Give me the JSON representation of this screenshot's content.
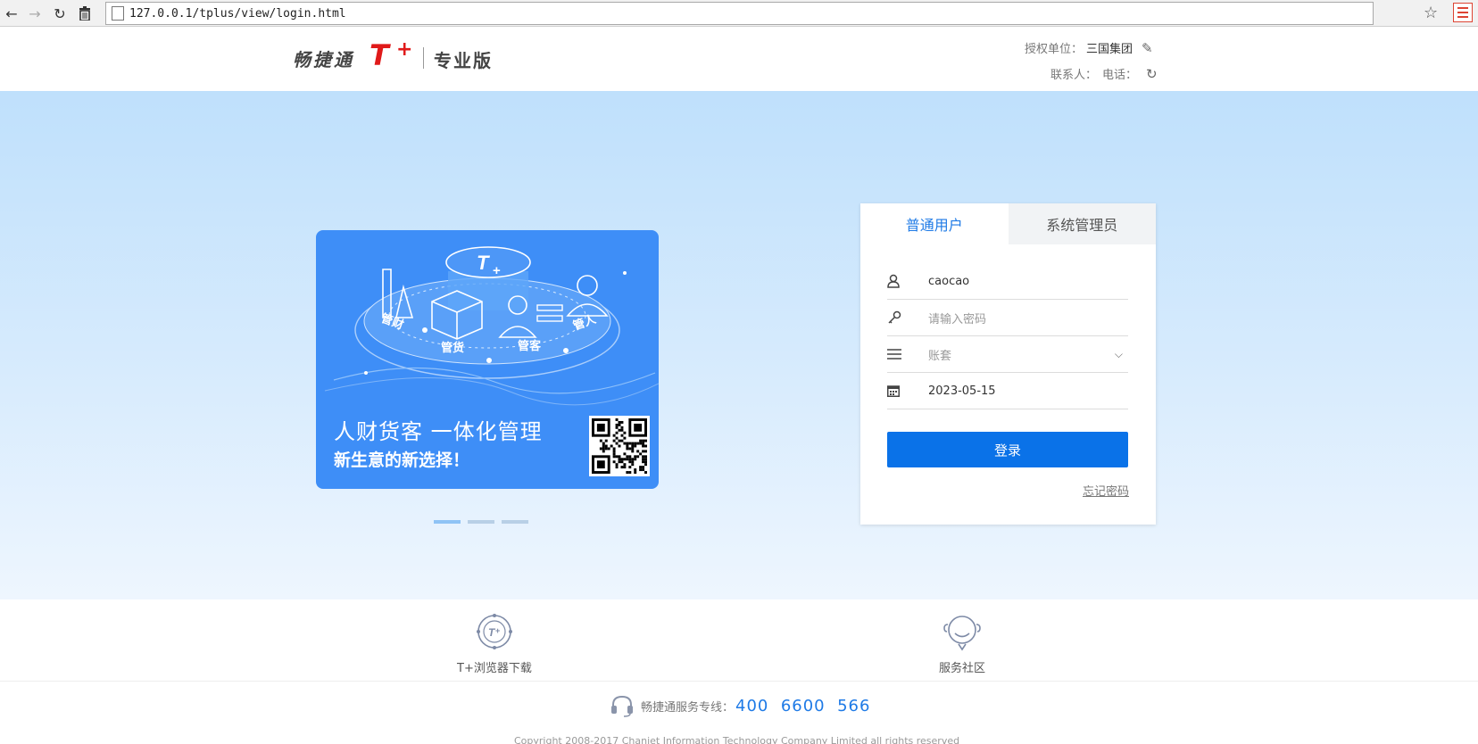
{
  "browser": {
    "url": "127.0.0.1/tplus/view/login.html",
    "back_icon": "back-arrow-icon",
    "forward_icon": "forward-arrow-icon",
    "reload_icon": "reload-icon",
    "trash_icon": "trash-icon",
    "bookmark_icon": "star-icon",
    "menu_icon": "hamburger-menu-icon"
  },
  "header": {
    "logo_text": "畅捷通",
    "logo_t": "T",
    "logo_plus": "+",
    "edition": "专业版",
    "auth_label": "授权单位：",
    "auth_value": "三国集团",
    "contact_label": "联系人：",
    "phone_label": "电话："
  },
  "banner": {
    "art_labels": [
      "管财",
      "管货",
      "管客",
      "管人"
    ],
    "headline": "人财货客 一体化管理",
    "subline": "新生意的新选择！"
  },
  "login": {
    "tabs": [
      {
        "label": "普通用户",
        "active": true
      },
      {
        "label": "系统管理员",
        "active": false
      }
    ],
    "username": "caocao",
    "password_placeholder": "请输入密码",
    "account_placeholder": "账套",
    "date": "2023-05-15",
    "submit_label": "登录",
    "forgot_label": "忘记密码"
  },
  "links": [
    {
      "label": "T+浏览器下载",
      "icon": "browser-download-icon"
    },
    {
      "label": "服务社区",
      "icon": "service-community-icon"
    }
  ],
  "footer": {
    "hotline_label": "畅捷通服务专线：",
    "hotline_number": "400  6600  566",
    "copyright": "Copyright 2008-2017 Chanjet Information Technology Company Limited all rights reserved"
  },
  "colors": {
    "accent": "#0a72e8",
    "logo_red": "#e01a1a",
    "banner_blue": "#3e8ef7"
  }
}
